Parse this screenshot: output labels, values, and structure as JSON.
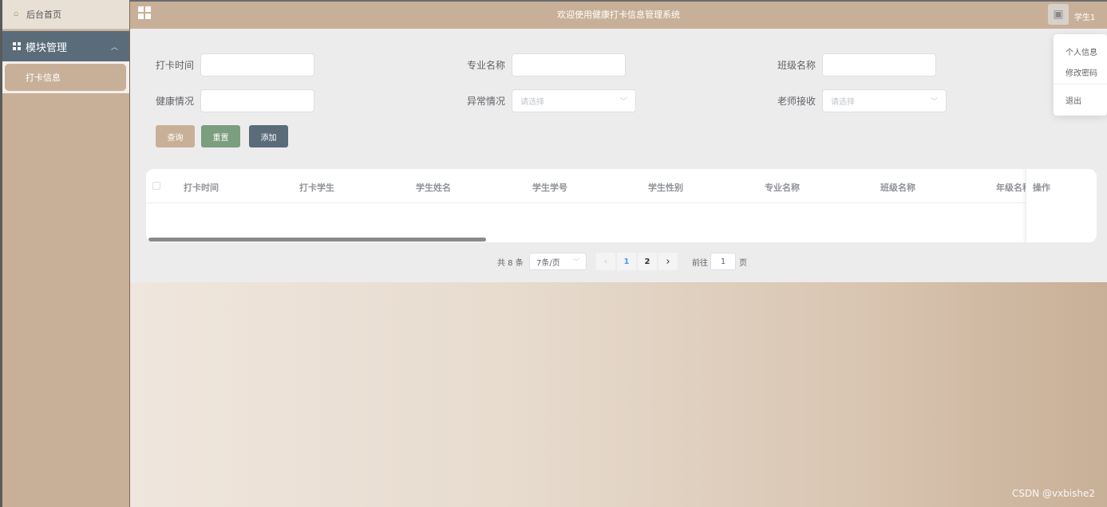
{
  "app": {
    "title": "欢迎使用健康打卡信息管理系统",
    "username": "学生1"
  },
  "sidebar": {
    "home_label": "后台首页",
    "module_label": "模块管理",
    "sub_item_label": "打卡信息"
  },
  "user_menu": {
    "items": [
      "个人信息",
      "修改密码",
      "退出"
    ]
  },
  "filters": {
    "checkin_time_label": "打卡时间",
    "major_label": "专业名称",
    "class_label": "班级名称",
    "health_label": "健康情况",
    "abnormal_label": "异常情况",
    "abnormal_placeholder": "请选择",
    "teacher_label": "老师接收",
    "teacher_placeholder": "请选择"
  },
  "buttons": {
    "query": "查询",
    "reset": "重置",
    "add": "添加"
  },
  "table": {
    "columns": [
      "打卡时间",
      "打卡学生",
      "学生姓名",
      "学生学号",
      "学生性别",
      "专业名称",
      "班级名称",
      "年级名称"
    ],
    "action_column": "操作",
    "rows": []
  },
  "pagination": {
    "total": "共 8 条",
    "page_size": "7条/页",
    "pages": [
      "1",
      "2"
    ],
    "current_page": 1,
    "goto_label": "前往",
    "goto_value": "1",
    "page_suffix": "页"
  },
  "watermark": "CSDN @vxbishe2",
  "colors": {
    "theme_tan": "#c8b098",
    "module_slate": "#5a6b7a",
    "btn_query": "#c8b098",
    "btn_reset": "#7a9e7e",
    "btn_add": "#5a6b7a",
    "active_page": "#409eff"
  }
}
